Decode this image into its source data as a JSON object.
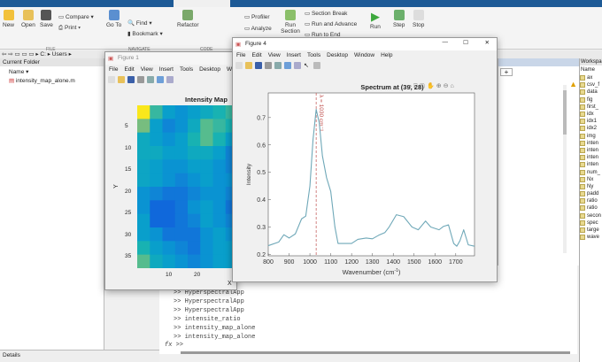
{
  "ribbon": {
    "file": {
      "new": "New",
      "open": "Open",
      "save": "Save",
      "compare": "Compare",
      "print": "Print",
      "section": "FILE"
    },
    "navigate": {
      "goto": "Go To",
      "find": "Find",
      "bookmark": "Bookmark",
      "section": "NAVIGATE"
    },
    "code": {
      "refactor": "Refactor",
      "profiler": "Profiler",
      "analyze": "Analyze",
      "section": "CODE"
    },
    "section": {
      "run_section": "Run Section",
      "section_break": "Section Break",
      "run_advance": "Run and Advance",
      "run_end": "Run to End"
    },
    "run": {
      "run": "Run",
      "step": "Step",
      "stop": "Stop"
    }
  },
  "address": {
    "path": [
      "C:",
      "Users"
    ]
  },
  "current_folder": {
    "title": "Current Folder",
    "name_col": "Name",
    "files": [
      "intensity_map_alone.m"
    ]
  },
  "details": {
    "label": "Details"
  },
  "figure1": {
    "title": "Figure 1",
    "menu": [
      "File",
      "Edit",
      "View",
      "Insert",
      "Tools",
      "Desktop",
      "Wi"
    ],
    "plot": {
      "title": "Intensity Map",
      "xlabel": "X",
      "ylabel": "Y",
      "yticks": [
        "5",
        "10",
        "15",
        "20",
        "25",
        "30",
        "35"
      ],
      "xticks": [
        "10",
        "20"
      ]
    }
  },
  "figure4": {
    "title": "Figure 4",
    "menu": [
      "File",
      "Edit",
      "View",
      "Insert",
      "Tools",
      "Desktop",
      "Window",
      "Help"
    ]
  },
  "chart_data": {
    "type": "line",
    "title": "Spectrum at (39, 28)",
    "xlabel": "Wavenumber (cm",
    "xlabel_sup": "-1",
    "xlabel_end": ")",
    "ylabel": "Intensity",
    "xlim": [
      800,
      1790
    ],
    "ylim": [
      0.195,
      0.79
    ],
    "xticks": [
      800,
      900,
      1000,
      1100,
      1200,
      1300,
      1400,
      1500,
      1600,
      1700
    ],
    "yticks": [
      0.2,
      0.3,
      0.4,
      0.5,
      0.6,
      0.7
    ],
    "annotation": {
      "x": 1030,
      "label": "λ = 1030 cm⁻¹",
      "color": "#c0504d"
    },
    "series": [
      {
        "name": "spectrum",
        "color": "#6fa8b8",
        "x": [
          800,
          850,
          875,
          900,
          930,
          960,
          980,
          1000,
          1015,
          1030,
          1045,
          1060,
          1080,
          1100,
          1120,
          1135,
          1200,
          1230,
          1270,
          1300,
          1330,
          1360,
          1380,
          1415,
          1450,
          1490,
          1520,
          1555,
          1580,
          1620,
          1640,
          1665,
          1690,
          1705,
          1720,
          1738,
          1760,
          1790
        ],
        "y": [
          0.232,
          0.245,
          0.272,
          0.26,
          0.275,
          0.33,
          0.34,
          0.45,
          0.62,
          0.73,
          0.68,
          0.56,
          0.48,
          0.43,
          0.3,
          0.24,
          0.24,
          0.255,
          0.26,
          0.257,
          0.27,
          0.28,
          0.3,
          0.345,
          0.338,
          0.3,
          0.29,
          0.322,
          0.3,
          0.29,
          0.302,
          0.308,
          0.24,
          0.23,
          0.25,
          0.29,
          0.235,
          0.23
        ]
      }
    ]
  },
  "heatmap": [
    [
      0.95,
      0.5,
      0.35,
      0.3,
      0.35,
      0.4,
      0.45,
      0.5
    ],
    [
      0.6,
      0.35,
      0.25,
      0.3,
      0.4,
      0.55,
      0.5,
      0.45
    ],
    [
      0.4,
      0.35,
      0.3,
      0.35,
      0.45,
      0.55,
      0.45,
      0.35
    ],
    [
      0.4,
      0.4,
      0.35,
      0.35,
      0.4,
      0.4,
      0.35,
      0.25
    ],
    [
      0.38,
      0.35,
      0.3,
      0.3,
      0.35,
      0.35,
      0.3,
      0.25
    ],
    [
      0.38,
      0.35,
      0.3,
      0.25,
      0.3,
      0.35,
      0.3,
      0.3
    ],
    [
      0.3,
      0.25,
      0.2,
      0.2,
      0.25,
      0.3,
      0.3,
      0.25
    ],
    [
      0.3,
      0.15,
      0.15,
      0.2,
      0.3,
      0.35,
      0.3,
      0.2
    ],
    [
      0.35,
      0.15,
      0.15,
      0.2,
      0.25,
      0.35,
      0.3,
      0.25
    ],
    [
      0.35,
      0.3,
      0.2,
      0.2,
      0.2,
      0.3,
      0.35,
      0.3
    ],
    [
      0.45,
      0.35,
      0.3,
      0.25,
      0.2,
      0.3,
      0.35,
      0.35
    ],
    [
      0.55,
      0.4,
      0.35,
      0.3,
      0.25,
      0.3,
      0.35,
      0.35
    ]
  ],
  "command_window": {
    "lines": [
      ">> HyperspectralApp",
      ">> HyperspectralApp",
      ">> HyperspectralApp",
      ">> intensite_ratio",
      ">> intensity_map_alone",
      ">> intensity_map_alone"
    ],
    "prompt": ">>",
    "fx": "fx"
  },
  "workspace": {
    "title": "Workspace",
    "name_col": "Name",
    "vars": [
      "ax",
      "csv_f",
      "data",
      "fig",
      "first_",
      "idx",
      "idx1",
      "idx2",
      "img",
      "inten",
      "inten",
      "inten",
      "inten",
      "num_",
      "Nx",
      "Ny",
      "padd",
      "ratio",
      "ratio",
      "secon",
      "spec",
      "targe",
      "wave"
    ]
  }
}
